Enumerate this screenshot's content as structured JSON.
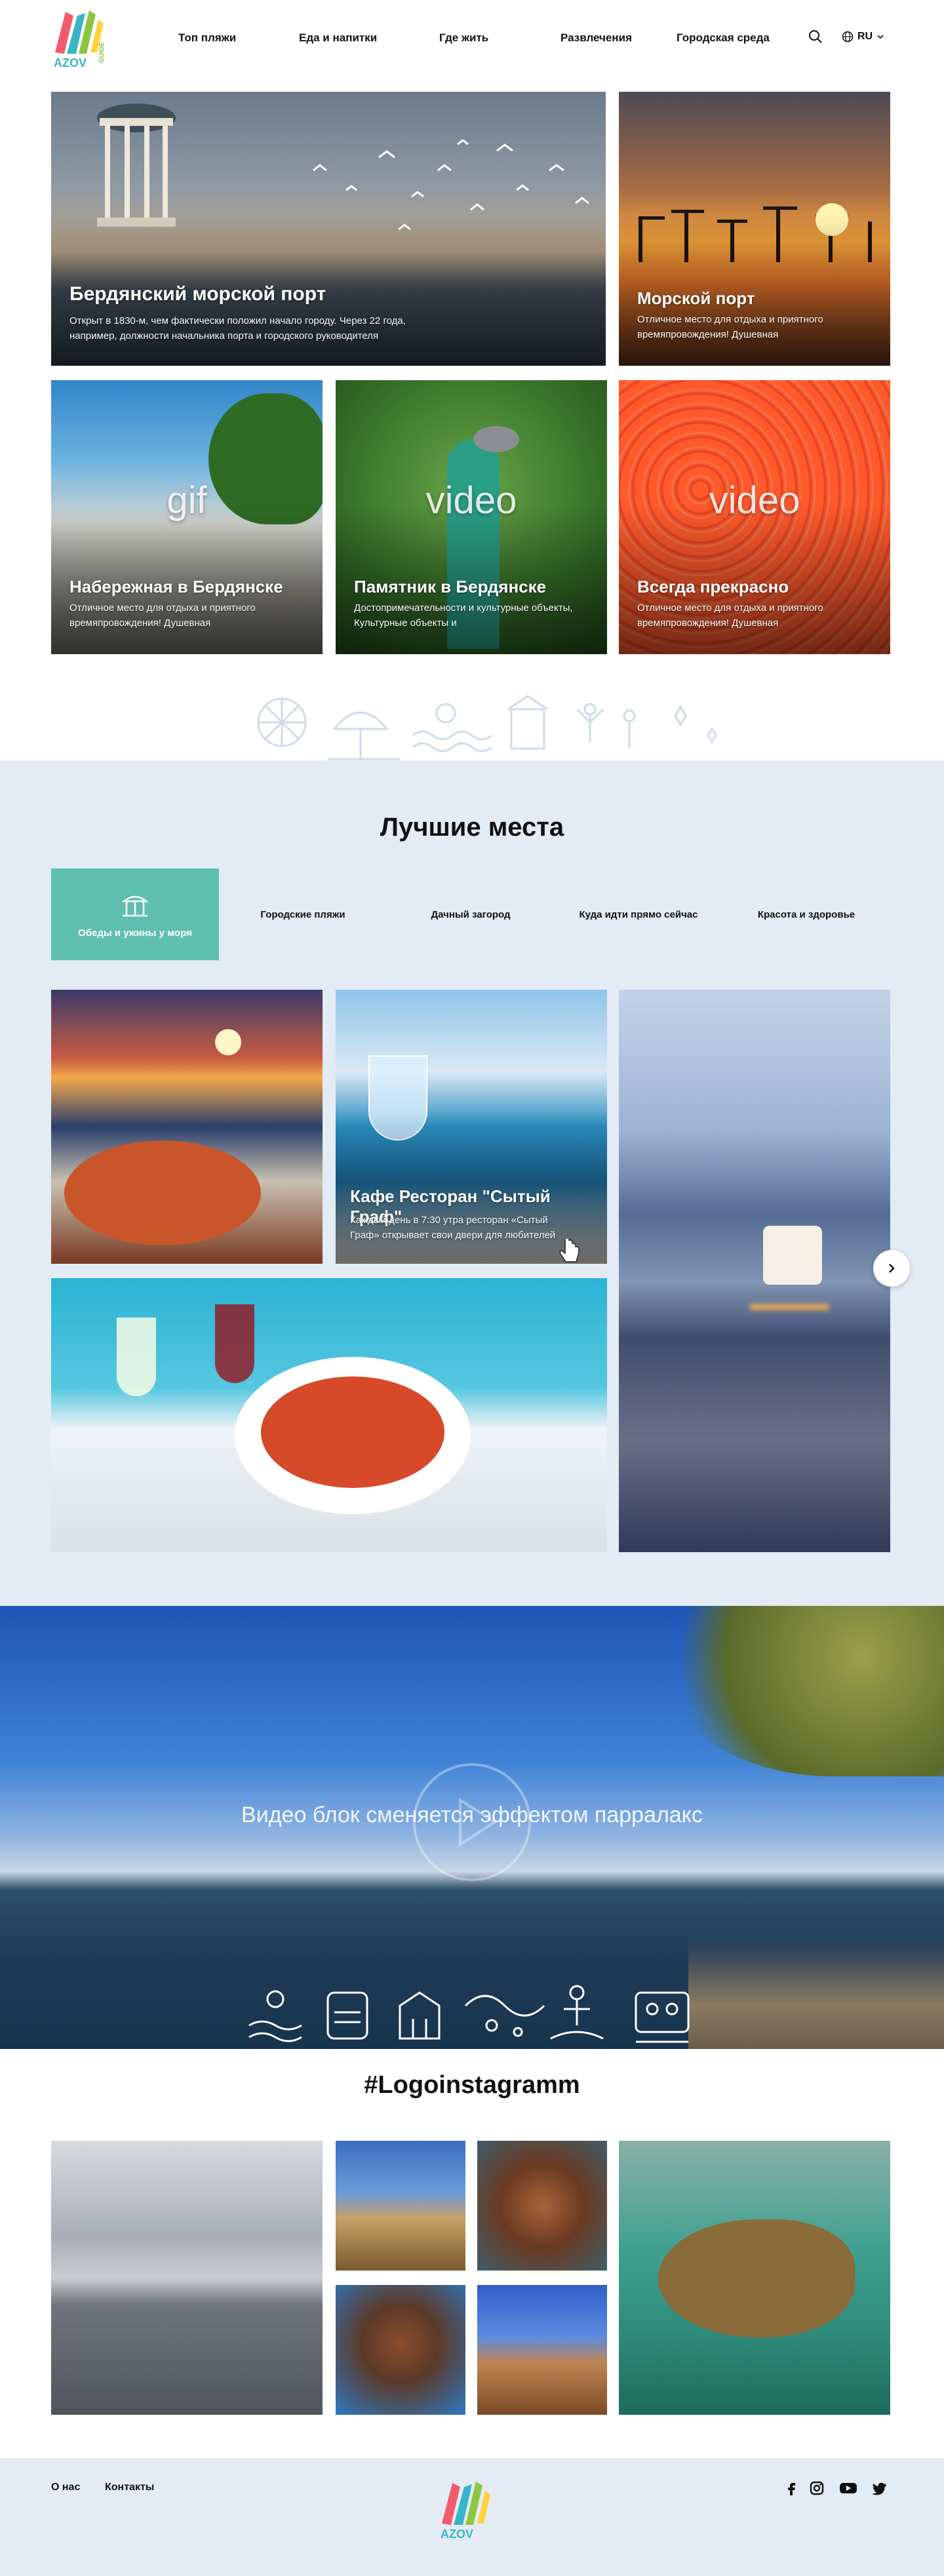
{
  "header": {
    "logo_text": "AZOV GUIDE",
    "nav": [
      "Топ пляжи",
      "Еда и напитки",
      "Где жить",
      "Развлечения",
      "Городская среда"
    ],
    "language": "RU"
  },
  "featured": [
    {
      "title": "Бердянский морской порт",
      "desc": "Открыт в 1830-м, чем фактически положил начало городу. Через 22 года, например, должности начальника порта и городского руководителя"
    },
    {
      "title": "Морской порт",
      "desc": "Отличное место для отдыха и приятного времяпровождения! Душевная"
    },
    {
      "title": "Набережная в Бердянске",
      "desc": "Отличное место для отдыха и приятного времяпровождения! Душевная",
      "media": "gif"
    },
    {
      "title": "Памятник в Бердянске",
      "desc": "Достопримечательности и культурные объекты, Культурные объекты и",
      "media": "video"
    },
    {
      "title": "Всегда прекрасно",
      "desc": "Отличное место для отдыха и приятного времяпровождения! Душевная",
      "media": "video"
    }
  ],
  "best": {
    "title": "Лучшие места",
    "tabs": [
      "Обеды и ужины у моря",
      "Городские пляжи",
      "Дачный загород",
      "Куда идти прямо сейчас",
      "Красота и здоровье"
    ],
    "active_tab": 0,
    "cafe_title": "Кафе Ресторан \"Сытый Граф\"",
    "cafe_desc": "Каждый день в 7:30 утра ресторан «Сытый Граф» открывает свои двери для любителей"
  },
  "video": {
    "text": "Видео блок сменяется эффектом парралакс"
  },
  "instagram": {
    "title": "#Logoinstagramm"
  },
  "footer": {
    "links": [
      "О нас",
      "Контакты"
    ],
    "social": [
      "facebook-icon",
      "instagram-icon",
      "youtube-icon",
      "twitter-icon"
    ]
  },
  "colors": {
    "accent": "#5fbfae",
    "section_bg": "#e3ebf5"
  }
}
